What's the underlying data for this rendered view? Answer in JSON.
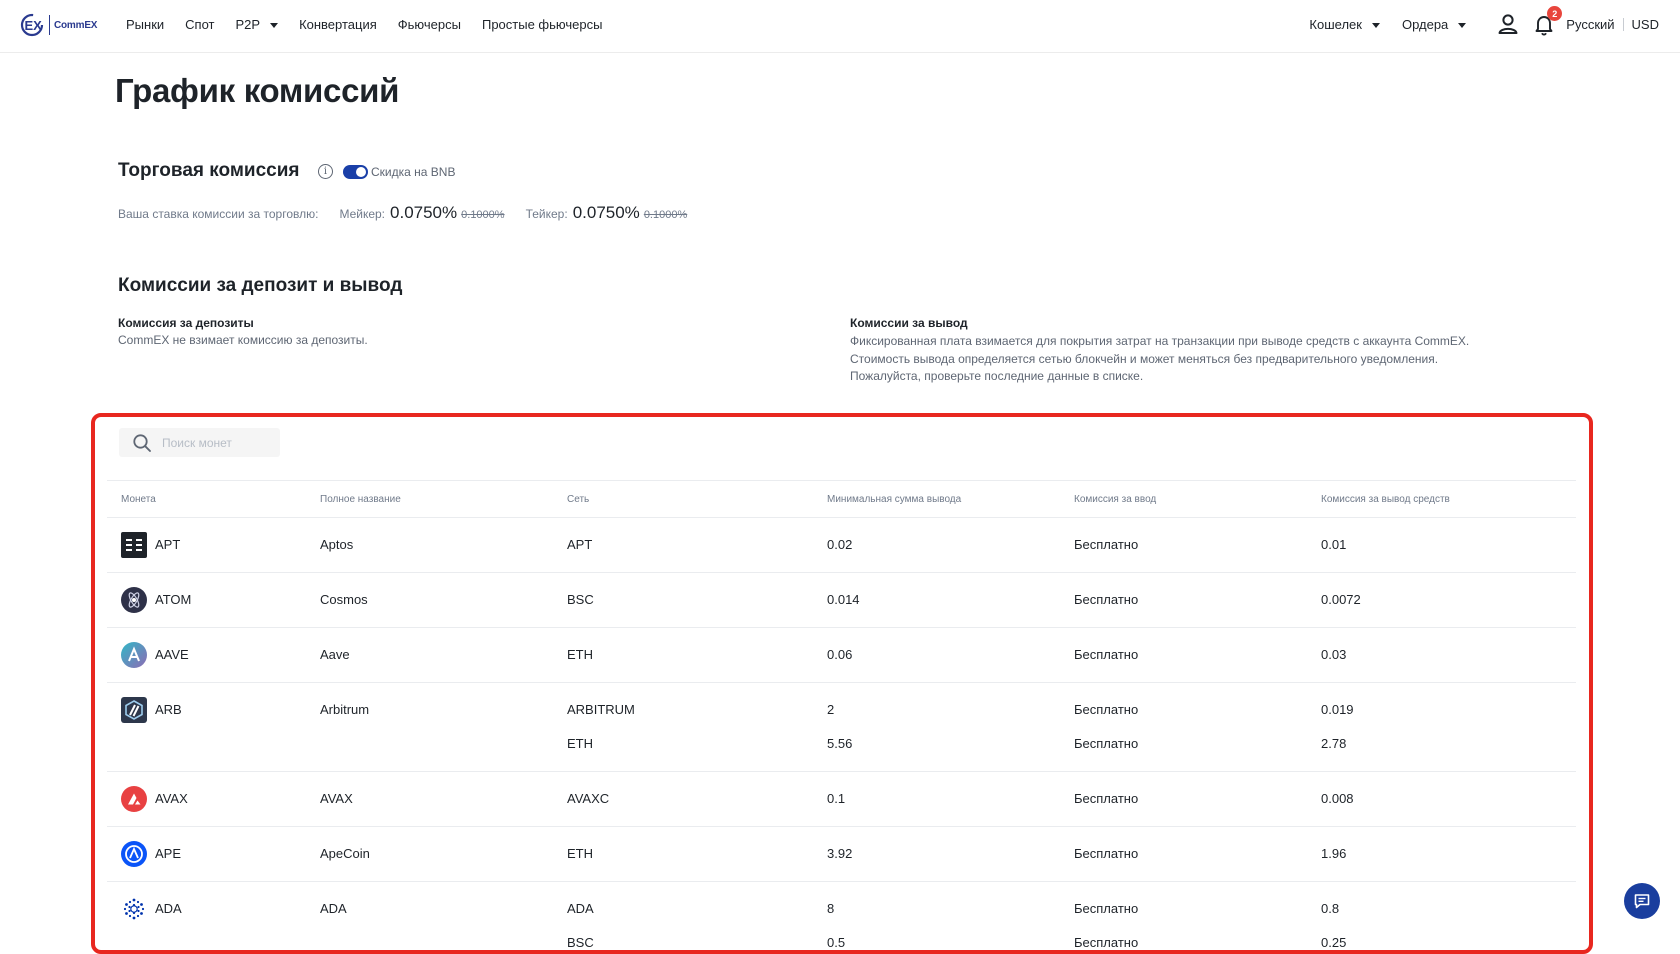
{
  "header": {
    "logo_text": "CommEX",
    "nav": [
      "Рынки",
      "Спот",
      "P2P",
      "Конвертация",
      "Фьючерсы",
      "Простые фьючерсы"
    ],
    "wallet": "Кошелек",
    "orders": "Ордера",
    "notification_count": "2",
    "language": "Русский",
    "currency": "USD"
  },
  "page": {
    "title": "График комиссий"
  },
  "trading": {
    "title": "Торговая комиссия",
    "info_glyph": "i",
    "bnb_discount_label": "Скидка на BNB",
    "bnb_discount_enabled": true,
    "rate_label": "Ваша ставка комиссии за торговлю:",
    "maker_label": "Мейкер:",
    "maker_rate": "0.0750%",
    "maker_old": "0.1000%",
    "taker_label": "Тейкер:",
    "taker_rate": "0.0750%",
    "taker_old": "0.1000%"
  },
  "fees": {
    "title": "Комиссии за депозит и вывод",
    "deposit_title": "Комиссия за депозиты",
    "deposit_text": "CommEX не взимает комиссию за депозиты.",
    "withdraw_title": "Комиссии за вывод",
    "withdraw_text": [
      "Фиксированная плата взимается для покрытия затрат на транзакции при выводе средств с аккаунта CommEX.",
      "Стоимость вывода определяется сетью блокчейн и может меняться без предварительного уведомления.",
      "Пожалуйста, проверьте последние данные в списке."
    ]
  },
  "table": {
    "search_placeholder": "Поиск монет",
    "columns": [
      "Монета",
      "Полное название",
      "Сеть",
      "Минимальная сумма вывода",
      "Комиссия за ввод",
      "Комиссия за вывод средств"
    ],
    "rows": [
      {
        "coin": "APT",
        "name": "Aptos",
        "icon": "aptos-icon",
        "icon_color": "#1e2329",
        "networks": [
          {
            "net": "APT",
            "min": "0.02",
            "dep": "Бесплатно",
            "wd": "0.01"
          }
        ]
      },
      {
        "coin": "ATOM",
        "name": "Cosmos",
        "icon": "cosmos-icon",
        "icon_color": "#2e3148",
        "networks": [
          {
            "net": "BSC",
            "min": "0.014",
            "dep": "Бесплатно",
            "wd": "0.0072"
          }
        ]
      },
      {
        "coin": "AAVE",
        "name": "Aave",
        "icon": "aave-icon",
        "icon_color": "#8e6bb5",
        "networks": [
          {
            "net": "ETH",
            "min": "0.06",
            "dep": "Бесплатно",
            "wd": "0.03"
          }
        ]
      },
      {
        "coin": "ARB",
        "name": "Arbitrum",
        "icon": "arbitrum-icon",
        "icon_color": "#2d374b",
        "networks": [
          {
            "net": "ARBITRUM",
            "min": "2",
            "dep": "Бесплатно",
            "wd": "0.019"
          },
          {
            "net": "ETH",
            "min": "5.56",
            "dep": "Бесплатно",
            "wd": "2.78"
          }
        ]
      },
      {
        "coin": "AVAX",
        "name": "AVAX",
        "icon": "avalanche-icon",
        "icon_color": "#e84142",
        "networks": [
          {
            "net": "AVAXC",
            "min": "0.1",
            "dep": "Бесплатно",
            "wd": "0.008"
          }
        ]
      },
      {
        "coin": "APE",
        "name": "ApeCoin",
        "icon": "apecoin-icon",
        "icon_color": "#0a54f8",
        "networks": [
          {
            "net": "ETH",
            "min": "3.92",
            "dep": "Бесплатно",
            "wd": "1.96"
          }
        ]
      },
      {
        "coin": "ADA",
        "name": "ADA",
        "icon": "cardano-icon",
        "icon_color": "#0033ad",
        "networks": [
          {
            "net": "ADA",
            "min": "8",
            "dep": "Бесплатно",
            "wd": "0.8"
          },
          {
            "net": "BSC",
            "min": "0.5",
            "dep": "Бесплатно",
            "wd": "0.25"
          }
        ]
      }
    ]
  },
  "colors": {
    "brand": "#1a3fa8",
    "highlight_border": "#e8271f",
    "badge": "#e8453c"
  }
}
